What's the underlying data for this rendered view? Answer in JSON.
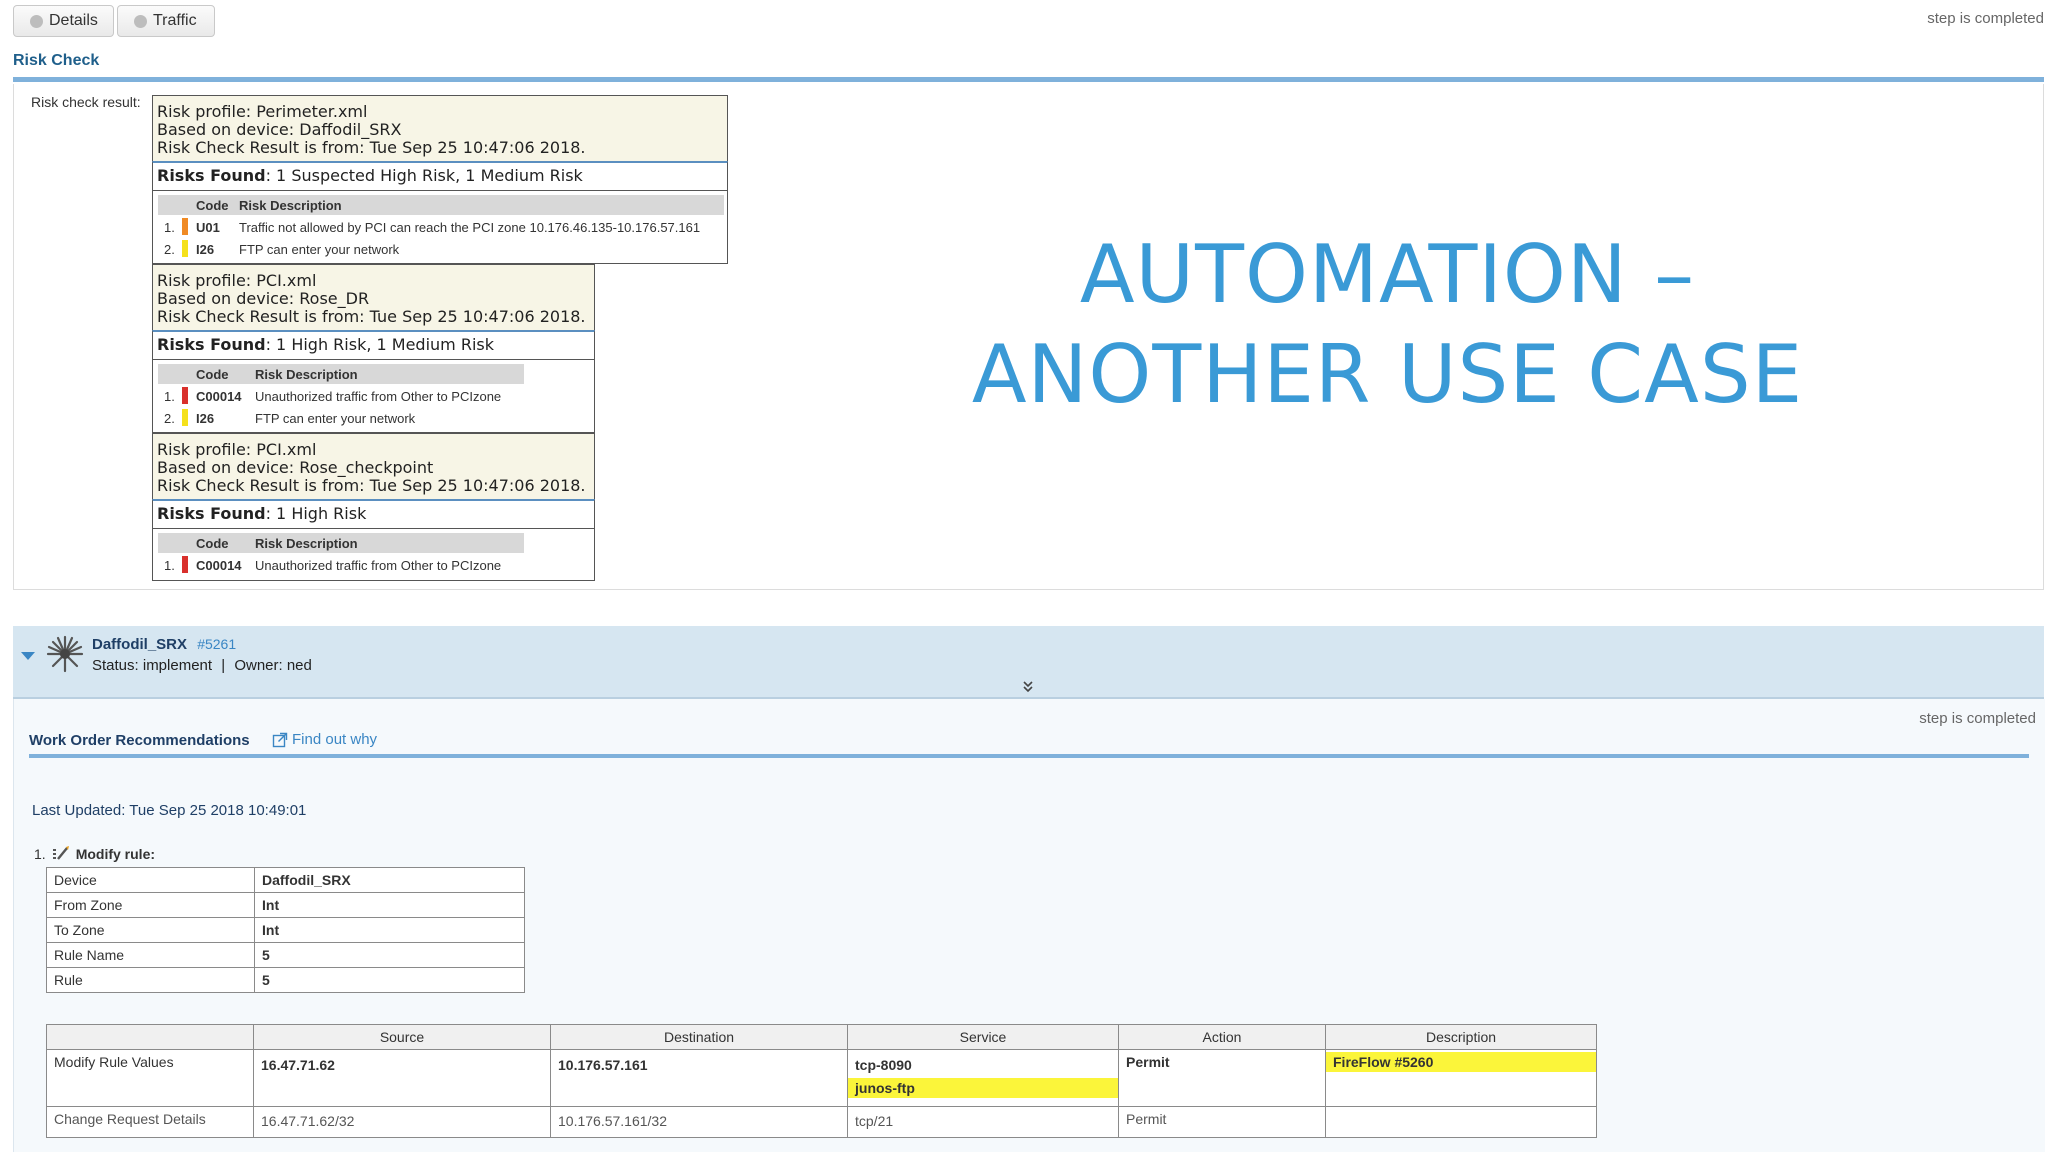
{
  "tabs": [
    {
      "label": "Details"
    },
    {
      "label": "Traffic"
    }
  ],
  "top_status": "step is completed",
  "risk_check": {
    "title": "Risk Check",
    "result_label": "Risk check result:",
    "profiles": [
      {
        "profile": "Risk profile: Perimeter.xml",
        "device": "Based on device: Daffodil_SRX",
        "date": "Risk Check Result is from: Tue Sep 25 10:47:06 2018.",
        "found_label": "Risks Found",
        "found_value": ": 1 Suspected High Risk, 1 Medium Risk",
        "col_code": "Code",
        "col_desc": "Risk Description",
        "rows": [
          {
            "num": "1.",
            "code": "U01",
            "desc": "Traffic not allowed by PCI can reach the PCI zone 10.176.46.135-10.176.57.161",
            "color": "#f08a24"
          },
          {
            "num": "2.",
            "code": "I26",
            "desc": "FTP can enter your network",
            "color": "#f5e11b"
          }
        ]
      },
      {
        "profile": "Risk profile: PCI.xml",
        "device": "Based on device: Rose_DR",
        "date": "Risk Check Result is from: Tue Sep 25 10:47:06 2018.",
        "found_label": "Risks Found",
        "found_value": ": 1 High Risk, 1 Medium Risk",
        "col_code": "Code",
        "col_desc": "Risk Description",
        "rows": [
          {
            "num": "1.",
            "code": "C00014",
            "desc": "Unauthorized traffic from Other to PCIzone",
            "color": "#d9302c"
          },
          {
            "num": "2.",
            "code": "I26",
            "desc": "FTP can enter your network",
            "color": "#f5e11b"
          }
        ]
      },
      {
        "profile": "Risk profile: PCI.xml",
        "device": "Based on device: Rose_checkpoint",
        "date": "Risk Check Result is from: Tue Sep 25 10:47:06 2018.",
        "found_label": "Risks Found",
        "found_value": ": 1 High Risk",
        "col_code": "Code",
        "col_desc": "Risk Description",
        "rows": [
          {
            "num": "1.",
            "code": "C00014",
            "desc": "Unauthorized traffic from Other to PCIzone",
            "color": "#d9302c"
          }
        ]
      }
    ]
  },
  "overlay": {
    "line1": "AUTOMATION –",
    "line2": "ANOTHER USE CASE"
  },
  "device": {
    "name": "Daffodil_SRX",
    "id": "#5261",
    "status": "Status: implement",
    "owner": "Owner: ned",
    "separator": "|"
  },
  "work_order": {
    "step_status": "step is completed",
    "title": "Work Order Recommendations",
    "find_out": "Find out why",
    "last_updated": "Last Updated: Tue Sep 25 2018 10:49:01",
    "item_num": "1.",
    "item_label": "Modify rule:",
    "kv": [
      {
        "key": "Device",
        "value": "Daffodil_SRX"
      },
      {
        "key": "From Zone",
        "value": "Int"
      },
      {
        "key": "To Zone",
        "value": "Int"
      },
      {
        "key": "Rule Name",
        "value": "5"
      },
      {
        "key": "Rule",
        "value": "5"
      }
    ],
    "columns": [
      "Source",
      "Destination",
      "Service",
      "Action",
      "Description"
    ],
    "rows": {
      "modify": {
        "label": "Modify Rule Values",
        "source": "16.47.71.62",
        "destination": "10.176.57.161",
        "service1": "tcp-8090",
        "service2": "junos-ftp",
        "action": "Permit",
        "description": "FireFlow #5260"
      },
      "change": {
        "label": "Change Request Details",
        "source": "16.47.71.62/32",
        "destination": "10.176.57.161/32",
        "service": "tcp/21",
        "action": "Permit",
        "description": ""
      }
    }
  },
  "colors": {
    "accent": "#1f5f8b",
    "rule": "#7fb1db",
    "highlight": "#fbf53a",
    "overlay": "#3a9ad6"
  }
}
